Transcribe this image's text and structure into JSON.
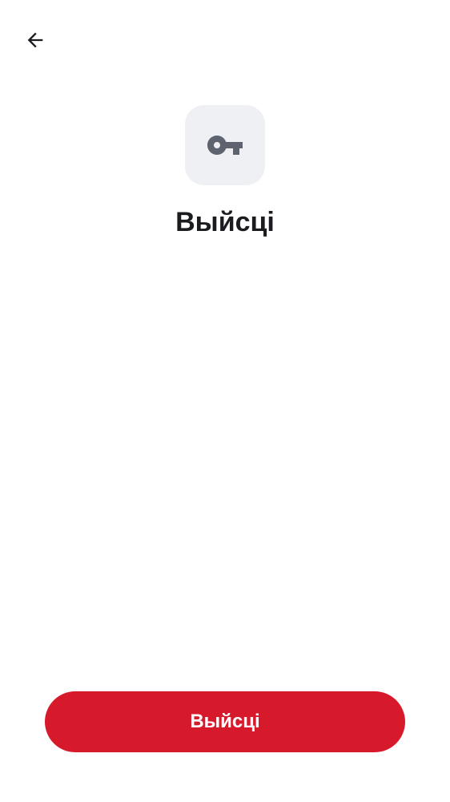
{
  "header": {
    "back_icon": "arrow-left-icon"
  },
  "hero": {
    "icon": "key-icon",
    "title": "Выйсці"
  },
  "footer": {
    "logout_label": "Выйсці"
  },
  "colors": {
    "accent": "#d71a2b",
    "icon_tile_bg": "#eff0f4",
    "icon_color": "#5f6370",
    "text": "#1b1c20"
  }
}
